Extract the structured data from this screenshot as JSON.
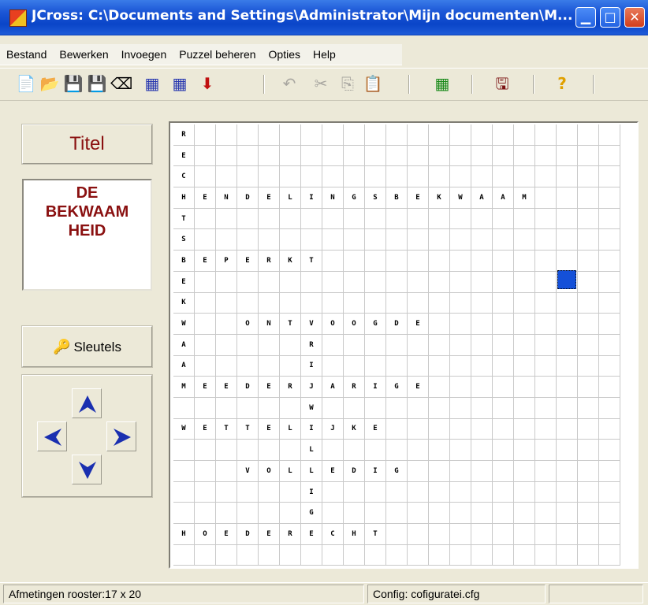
{
  "window": {
    "title": "JCross: C:\\Documents and Settings\\Administrator\\Mijn documenten\\M...",
    "min_glyph": "▁",
    "max_glyph": "□",
    "close_glyph": "✕"
  },
  "menu": [
    "Bestand",
    "Bewerken",
    "Invoegen",
    "Puzzel beheren",
    "Opties",
    "Help"
  ],
  "toolbar": {
    "new_icon": "📄",
    "open_icon": "📂",
    "save_icon": "💾",
    "save_as_icon": "💾",
    "eraser_icon": "⌫",
    "grid1_icon": "▦",
    "grid2_icon": "▦",
    "arrow_down_icon": "⬇",
    "undo_icon": "↶",
    "cut_icon": "✂",
    "copy_icon": "⎘",
    "paste_icon": "📋",
    "build_icon": "▦",
    "export_icon": "🖫",
    "help_icon": "?"
  },
  "panel": {
    "title_button": "Titel",
    "title_lines": [
      "DE",
      "BEKWAAM",
      "HEID"
    ],
    "key_icon": "🔑",
    "keys_button": "Sleutels"
  },
  "grid": {
    "rows": [
      "R                    ",
      "E                    ",
      "C                    ",
      "HENDELINGSBEKWAAM    ",
      "T                    ",
      "S                    ",
      "BEPERKT              ",
      "E                    ",
      "K                    ",
      "W  ONTVOOGDE         ",
      "A     R              ",
      "A     I              ",
      "MEEDERJARIGE         ",
      "      W              ",
      "WETTELIJKE           ",
      "      L              ",
      "   VOLLEDIG          ",
      "      I              ",
      "      G              ",
      "HOEDERECHT           ",
      "                     "
    ]
  },
  "status": {
    "dimensions": "Afmetingen rooster:17 x 20",
    "config": "Config: cofiguratei.cfg",
    "extra": ""
  },
  "colors": {
    "titlebar": "#0A45C8",
    "accent_red": "#8A1010",
    "cursor": "#1450D8",
    "arrow_blue": "#1A2FB0"
  }
}
